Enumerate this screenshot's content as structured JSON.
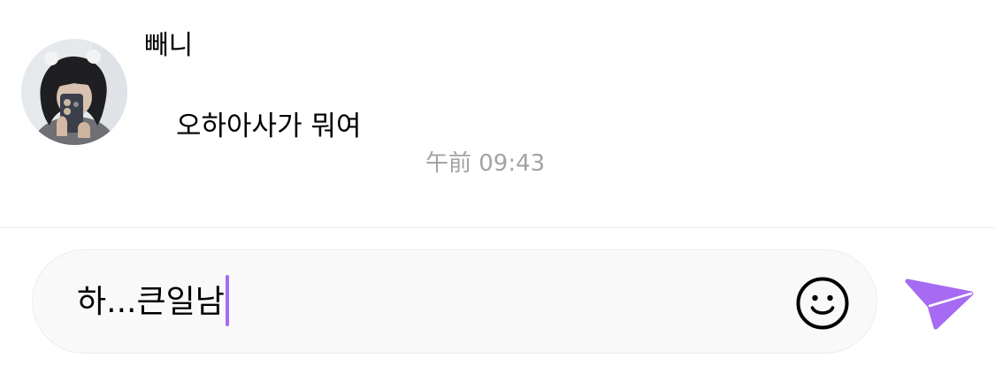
{
  "chat": {
    "sender": {
      "name": "빼니",
      "avatar": "avatar-photo"
    },
    "message": {
      "text": "오하아사가 뭐여",
      "timestamp": "午前 09:43"
    }
  },
  "composer": {
    "value": "하...큰일남",
    "emoji_icon": "smiley-icon",
    "send_icon": "paper-plane-icon",
    "accent_color": "#a66bf2"
  }
}
